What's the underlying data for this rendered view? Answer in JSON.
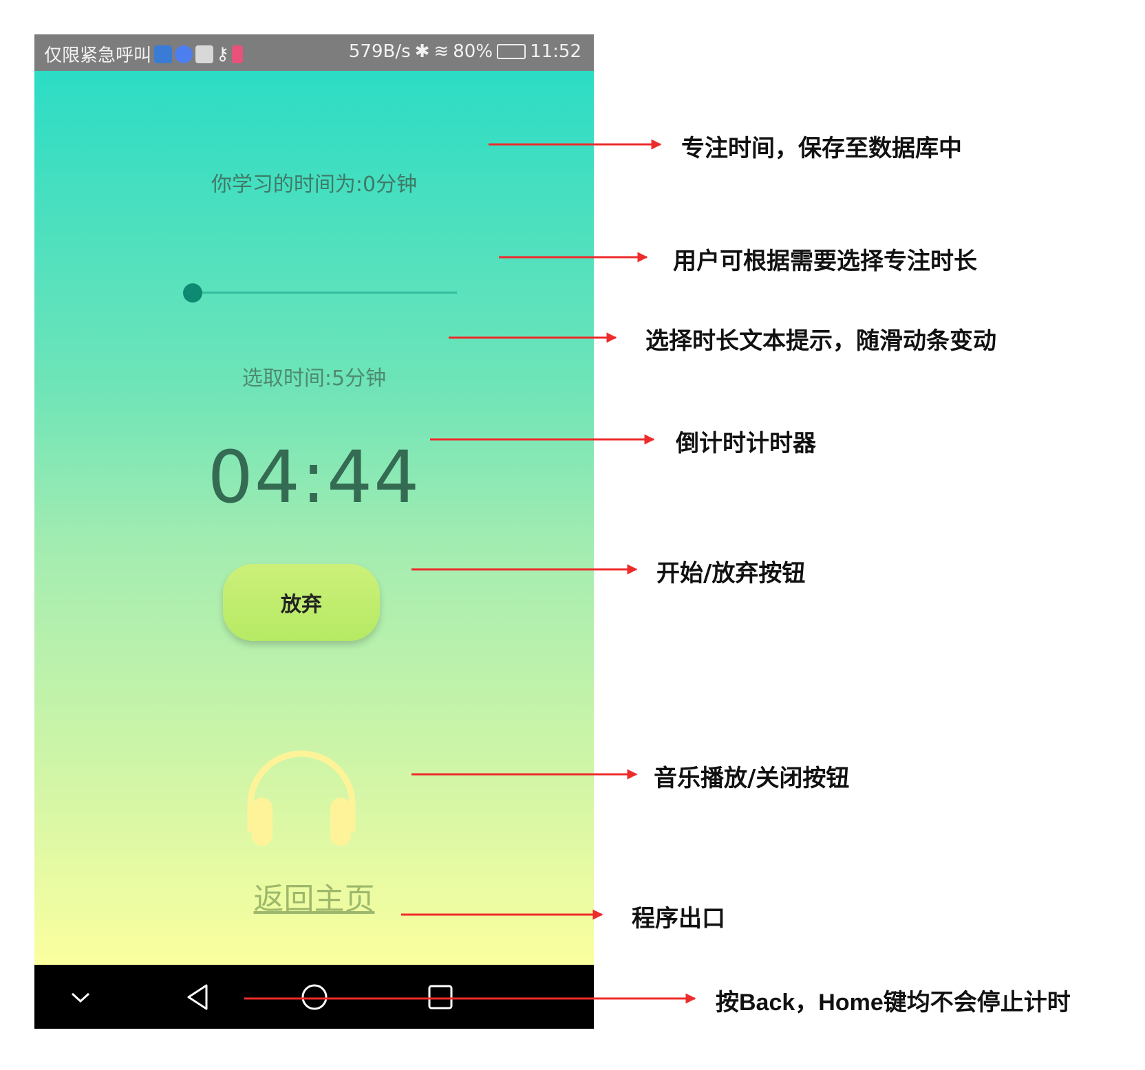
{
  "status_bar": {
    "left_text": "仅限紧急呼叫",
    "speed": "579B/s",
    "battery": "80%",
    "time": "11:52"
  },
  "app": {
    "study_time": "你学习的时间为:0分钟",
    "slider_value_fraction": 0.0,
    "select_time": "选取时间:5分钟",
    "countdown": "04:44",
    "giveup_button": "放弃",
    "back_home_link": "返回主页",
    "colors": {
      "gradient_top": "#2cdcc5",
      "gradient_bottom": "#fbff9f",
      "button": "#c2ee6e",
      "headphones": "#fff39a"
    }
  },
  "annotations": {
    "focus_time": "专注时间，保存至数据库中",
    "duration_select": "用户可根据需要选择专注时长",
    "duration_hint": "选择时长文本提示，随滑动条变动",
    "countdown_timer": "倒计时计时器",
    "start_giveup": "开始/放弃按钮",
    "music_toggle": "音乐播放/关闭按钮",
    "program_exit": "程序出口",
    "back_home_note_prefix": "按",
    "back_word": "Back",
    "comma": "，",
    "home_word": "Home",
    "back_home_note_suffix": "键均不会停止计时"
  },
  "arrow_color": "#ee2b2b"
}
